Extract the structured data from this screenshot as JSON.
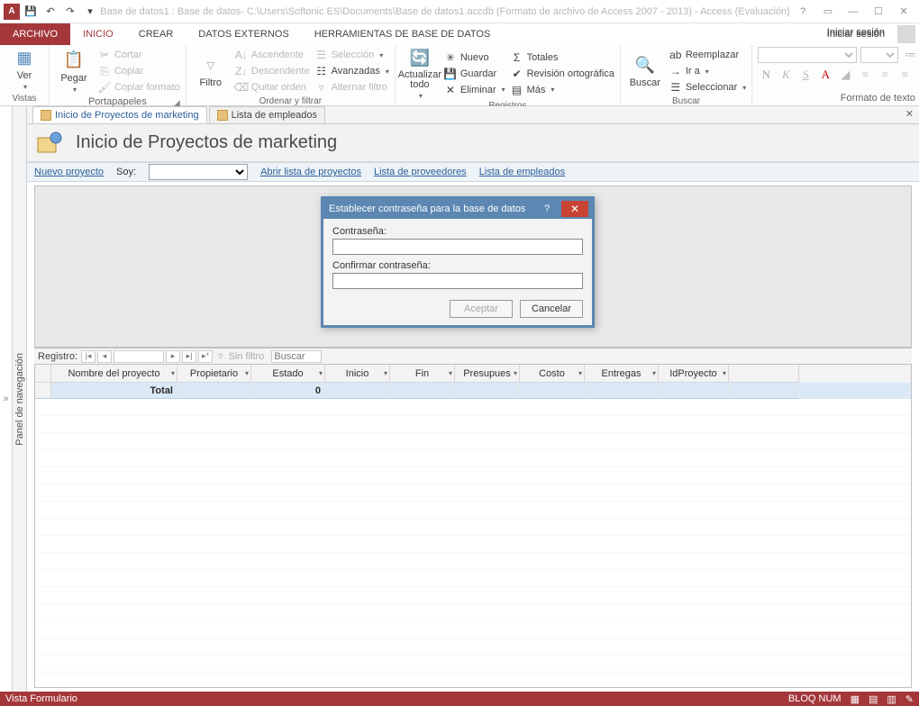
{
  "title": "Base de datos1 : Base de datos- C:\\Users\\Softonic ES\\Documents\\Base de datos1.accdb (Formato de archivo de Access 2007 - 2013) - Access (Evaluación)",
  "signin": "Iniciar sesión",
  "tabs": {
    "file": "ARCHIVO",
    "home": "INICIO",
    "create": "CREAR",
    "external": "DATOS EXTERNOS",
    "dbtools": "HERRAMIENTAS DE BASE DE DATOS"
  },
  "ribbon": {
    "views": {
      "view": "Ver",
      "label": "Vistas"
    },
    "clipboard": {
      "paste": "Pegar",
      "cut": "Cortar",
      "copy": "Copiar",
      "format": "Copiar formato",
      "label": "Portapapeles"
    },
    "sort": {
      "filter": "Filtro",
      "asc": "Ascendente",
      "desc": "Descendente",
      "clear": "Quitar orden",
      "sel": "Selección",
      "adv": "Avanzadas",
      "toggle": "Alternar filtro",
      "label": "Ordenar y filtrar"
    },
    "records": {
      "refresh": "Actualizar todo",
      "new": "Nuevo",
      "save": "Guardar",
      "delete": "Eliminar",
      "totals": "Totales",
      "spell": "Revisión ortográfica",
      "more": "Más",
      "label": "Registros"
    },
    "find": {
      "find": "Buscar",
      "replace": "Reemplazar",
      "goto": "Ir a",
      "select": "Seleccionar",
      "label": "Buscar"
    },
    "textfmt": {
      "label": "Formato de texto",
      "bold": "N",
      "italic": "K",
      "underline": "S"
    }
  },
  "nav_panel": "Panel de navegación",
  "doc_tabs": {
    "t1": "Inicio de Proyectos de marketing",
    "t2": "Lista de empleados"
  },
  "form": {
    "title": "Inicio de Proyectos de marketing"
  },
  "toolbar": {
    "newproj": "Nuevo proyecto",
    "soy": "Soy:",
    "openlist": "Abrir lista de proyectos",
    "suppliers": "Lista de proveedores",
    "employees": "Lista de empleados"
  },
  "recnav": {
    "label": "Registro:",
    "nofilter": "Sin filtro",
    "search": "Buscar"
  },
  "columns": [
    "",
    "Nombre del proyecto",
    "Propietario",
    "Estado",
    "Inicio",
    "Fin",
    "Presupues",
    "Costo",
    "Entregas",
    "IdProyecto",
    ""
  ],
  "totals": {
    "label": "Total",
    "val": "0"
  },
  "dialog": {
    "title": "Establecer contraseña para la base de datos",
    "pwd": "Contraseña:",
    "confirm": "Confirmar contraseña:",
    "ok": "Aceptar",
    "cancel": "Cancelar"
  },
  "status": {
    "view": "Vista Formulario",
    "numlock": "BLOQ NUM"
  }
}
